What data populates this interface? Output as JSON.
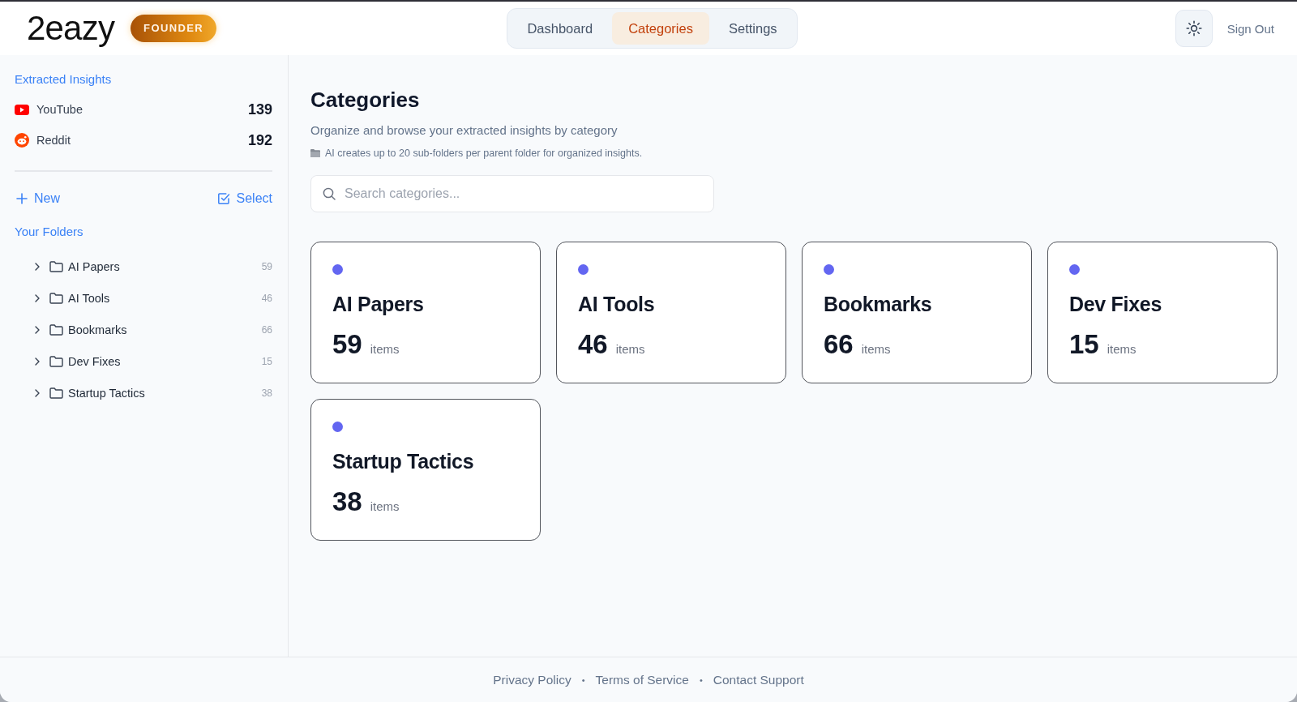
{
  "header": {
    "logo": "2eazy",
    "badge": "FOUNDER",
    "tabs": [
      {
        "label": "Dashboard",
        "selected": false
      },
      {
        "label": "Categories",
        "selected": true
      },
      {
        "label": "Settings",
        "selected": false
      }
    ],
    "sign_out": "Sign Out"
  },
  "sidebar": {
    "insights_title": "Extracted Insights",
    "sources": [
      {
        "kind": "youtube",
        "name": "YouTube",
        "count": "139"
      },
      {
        "kind": "reddit",
        "name": "Reddit",
        "count": "192"
      }
    ],
    "new_button": "New",
    "select_button": "Select",
    "folders_title": "Your Folders",
    "folders": [
      {
        "name": "AI Papers",
        "count": "59",
        "expanded": false
      },
      {
        "name": "AI Tools",
        "count": "46",
        "expanded": false
      },
      {
        "name": "Bookmarks",
        "count": "66",
        "expanded": false
      },
      {
        "name": "Dev Fixes",
        "count": "15",
        "expanded": false
      },
      {
        "name": "Startup Tactics",
        "count": "38",
        "expanded": false
      }
    ]
  },
  "main": {
    "title": "Categories",
    "subtitle": "Organize and browse your extracted insights by category",
    "note": "AI creates up to 20 sub-folders per parent folder for organized insights.",
    "search": {
      "placeholder": "Search categories..."
    },
    "cards": [
      {
        "name": "AI Papers",
        "count": "59",
        "unit": "items"
      },
      {
        "name": "AI Tools",
        "count": "46",
        "unit": "items"
      },
      {
        "name": "Bookmarks",
        "count": "66",
        "unit": "items"
      },
      {
        "name": "Dev Fixes",
        "count": "15",
        "unit": "items"
      },
      {
        "name": "Startup Tactics",
        "count": "38",
        "unit": "items"
      }
    ]
  },
  "footer": {
    "items": [
      {
        "kind": "link",
        "label": "Privacy Policy"
      },
      {
        "kind": "separator",
        "label": "•"
      },
      {
        "kind": "link",
        "label": "Terms of Service"
      },
      {
        "kind": "separator",
        "label": "•"
      },
      {
        "kind": "link",
        "label": "Contact Support"
      }
    ]
  }
}
